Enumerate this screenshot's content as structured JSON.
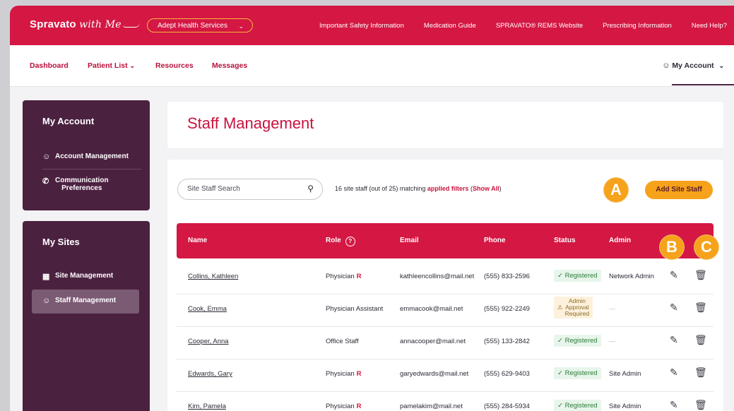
{
  "header": {
    "brand": "Spravato",
    "brand_with": "with Me",
    "site_select": "Adept Health Services",
    "links": [
      "Important Safety Information",
      "Medication Guide",
      "SPRAVATO® REMS Website",
      "Prescribing Information",
      "Need Help?"
    ]
  },
  "nav": {
    "dashboard": "Dashboard",
    "patient_list": "Patient List",
    "resources": "Resources",
    "messages": "Messages",
    "my_account": "My Account"
  },
  "sidebar": {
    "account_title": "My Account",
    "account_management": "Account Management",
    "comm_prefs_1": "Communication",
    "comm_prefs_2": "Preferences",
    "sites_title": "My Sites",
    "site_management": "Site Management",
    "staff_management": "Staff Management"
  },
  "main": {
    "title": "Staff Management",
    "search_placeholder": "Site Staff Search",
    "summary_prefix": "16 site staff (out of 25) matching",
    "summary_filters": "applied filters",
    "summary_open": "(",
    "summary_showall": "Show All",
    "summary_close": ")",
    "add_button": "Add Site Staff",
    "callouts": [
      "A",
      "B",
      "C"
    ]
  },
  "table": {
    "headers": {
      "name": "Name",
      "role": "Role",
      "email": "Email",
      "phone": "Phone",
      "status": "Status",
      "admin": "Admin"
    },
    "rows": [
      {
        "name": "Collins, Kathleen",
        "role": "Physician",
        "r": "R",
        "email": "kathleencollins@mail.net",
        "phone": "(555) 833-2596",
        "status": "Registered",
        "admin": "Network Admin"
      },
      {
        "name": "Cook, Emma",
        "role": "Physician Assistant",
        "r": "",
        "email": "emmacook@mail.net",
        "phone": "(555) 922-2249",
        "status_l1": "Admin",
        "status_l2": "Approval",
        "status_l3": "Required",
        "admin": "—"
      },
      {
        "name": "Cooper, Anna",
        "role": "Office Staff",
        "r": "",
        "email": "annacooper@mail.net",
        "phone": "(555) 133-2842",
        "status": "Registered",
        "admin": "—"
      },
      {
        "name": "Edwards, Gary",
        "role": "Physician",
        "r": "R",
        "email": "garyedwards@mail.net",
        "phone": "(555) 629-9403",
        "status": "Registered",
        "admin": "Site Admin"
      },
      {
        "name": "Kim, Pamela",
        "role": "Physician",
        "r": "R",
        "email": "pamelakim@mail.net",
        "phone": "(555) 284-5934",
        "status": "Registered",
        "admin": "Site Admin"
      }
    ]
  },
  "icons": {
    "edit": "edit-icon",
    "delete": "trash-icon",
    "search": "search-icon",
    "check": "check-icon",
    "warning": "warning-icon"
  },
  "colors": {
    "brand_red": "#d41743",
    "plum": "#4b2140",
    "accent_orange": "#f6a21b"
  }
}
